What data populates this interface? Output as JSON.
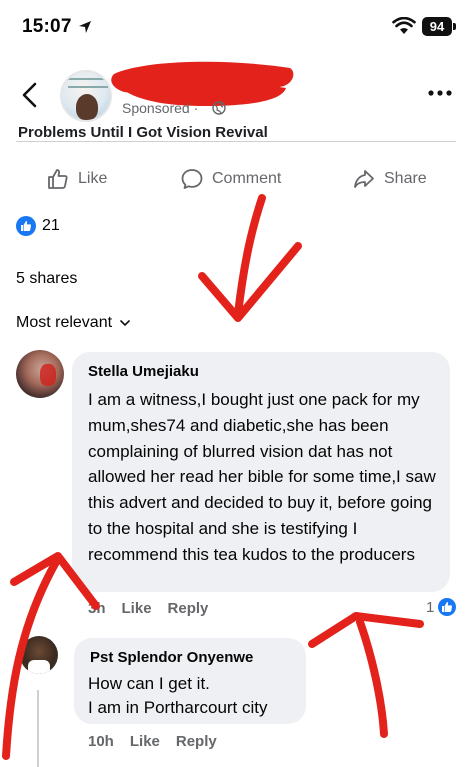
{
  "status_bar": {
    "time": "15:07",
    "battery": "94"
  },
  "post": {
    "sponsored_label": "Sponsored ·",
    "caption_preview": "Problems Until I Got Vision Revival",
    "actions": {
      "like": "Like",
      "comment": "Comment",
      "share": "Share"
    },
    "reaction_count": "21",
    "shares": "5 shares",
    "sort_label": "Most relevant"
  },
  "comments": [
    {
      "author": "Stella Umejiaku",
      "text": "I am a witness,I bought just one pack for my mum,shes74 and diabetic,she has been complaining of blurred vision dat has not allowed her read her bible for some time,I saw this advert and decided to buy it, before going to the hospital and she is testifying I recommend this tea kudos to the producers",
      "time": "3h",
      "like": "Like",
      "reply": "Reply",
      "reactions": "1"
    },
    {
      "author": "Pst Splendor Onyenwe",
      "line1": "How can I get it.",
      "line2": "I am in Portharcourt city",
      "time": "10h",
      "like": "Like",
      "reply": "Reply"
    }
  ],
  "colors": {
    "brand": "#1877f2",
    "annotation": "#e3231b",
    "bubble": "#eef0f3",
    "muted": "#65676b"
  }
}
